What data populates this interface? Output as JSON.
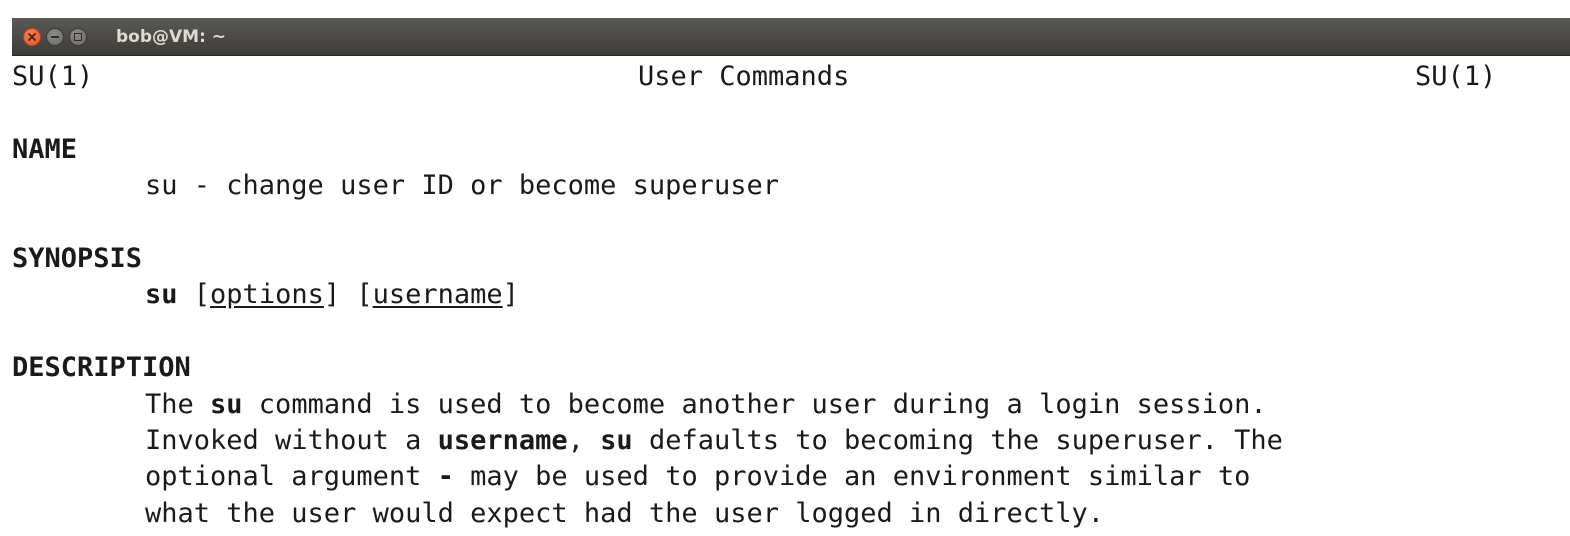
{
  "window": {
    "title": "bob@VM: ~",
    "buttons": [
      "close-icon",
      "minimize-icon",
      "maximize-icon"
    ]
  },
  "man": {
    "header_left": "SU(1)",
    "header_center": "User Commands",
    "header_right": "SU(1)",
    "name_heading": "NAME",
    "name_text": "su - change user ID or become superuser",
    "synopsis_heading": "SYNOPSIS",
    "synopsis": {
      "cmd": "su",
      "open1": "[",
      "options": "options",
      "close1_open2": "] [",
      "username": "username",
      "close2": "]"
    },
    "description_heading": "DESCRIPTION",
    "desc_line1": {
      "a": "The ",
      "b": "su",
      "c": " command is used to become another user during a login session."
    },
    "desc_line2": {
      "a": "Invoked without a ",
      "b": "username",
      "c": ", ",
      "d": "su",
      "e": " defaults to becoming the superuser. The"
    },
    "desc_line3": {
      "a": "optional argument ",
      "b": "-",
      "c": " may be used to provide an environment similar to"
    },
    "desc_line4": "what the user would expect had the user logged in directly."
  }
}
